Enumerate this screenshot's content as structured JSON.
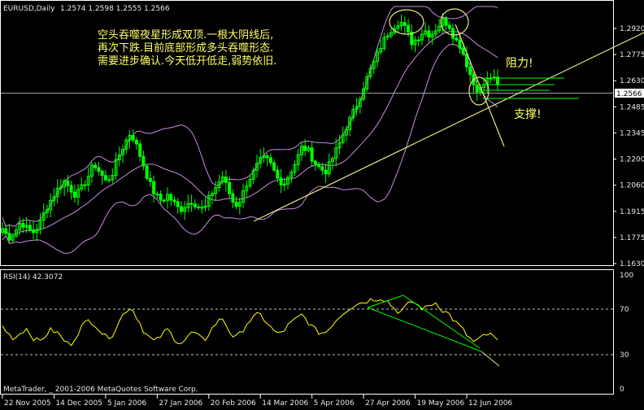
{
  "header": {
    "symbol": "EURUSD,Daily",
    "ohlc": "1.2574 1.2598 1.2555 1.2566"
  },
  "annotations": {
    "note_line1": "空头吞噬夜星形成双顶.一根大阴线后,",
    "note_line2": "再次下跌.目前底部形成多头吞噬形态.",
    "note_line3": "需要进步确认.今天低开低走,弱势依旧.",
    "resistance": "阻力!",
    "support": "支撑!"
  },
  "rsi_panel": {
    "title": "RSI(14) 42.3072",
    "copyright": "MetaTrader, _ 2001-2006 MetaQuotes Software Corp."
  },
  "colors": {
    "background": "#000000",
    "candle": "#00ff00",
    "bands": "#c88ce0",
    "trendline": "#e8e880",
    "rsi_line": "#ffff00",
    "axis": "#ffffff",
    "annotation_text": "#ffff66"
  },
  "chart_data": [
    {
      "type": "candlestick",
      "title": "EURUSD,Daily",
      "current_price": "1.2566",
      "ylim": [
        1.163,
        1.2995
      ],
      "y_ticks": [
        "1.2920",
        "1.2775",
        "1.2630",
        "1.2485",
        "1.2345",
        "1.2200",
        "1.2060",
        "1.1915",
        "1.1775",
        "1.1630"
      ],
      "x_ticks": [
        "22 Nov 2005",
        "14 Dec 2005",
        "5 Jan 2006",
        "27 Jan 2006",
        "20 Feb 2006",
        "14 Mar 2006",
        "5 Apr 2006",
        "27 Apr 2006",
        "19 May 2006",
        "12 Jun 2006"
      ],
      "indicators": [
        "Bollinger Bands"
      ],
      "close_path": [
        1.18,
        1.175,
        1.178,
        1.184,
        1.18,
        1.178,
        1.182,
        1.19,
        1.196,
        1.201,
        1.206,
        1.202,
        1.198,
        1.202,
        1.208,
        1.215,
        1.21,
        1.205,
        1.21,
        1.219,
        1.226,
        1.232,
        1.224,
        1.215,
        1.205,
        1.198,
        1.195,
        1.198,
        1.194,
        1.19,
        1.193,
        1.195,
        1.192,
        1.19,
        1.198,
        1.203,
        1.208,
        1.2,
        1.192,
        1.196,
        1.205,
        1.21,
        1.216,
        1.218,
        1.214,
        1.207,
        1.204,
        1.21,
        1.216,
        1.224,
        1.222,
        1.216,
        1.212,
        1.211,
        1.218,
        1.225,
        1.233,
        1.24,
        1.247,
        1.256,
        1.264,
        1.271,
        1.279,
        1.285,
        1.289,
        1.292,
        1.287,
        1.28,
        1.283,
        1.287,
        1.284,
        1.288,
        1.292,
        1.29,
        1.282,
        1.278,
        1.268,
        1.258,
        1.254,
        1.259,
        1.262,
        1.257
      ]
    },
    {
      "type": "line",
      "title": "RSI(14) 42.3072",
      "value": 42.3072,
      "ylim": [
        0,
        100
      ],
      "y_ticks": [
        "100",
        "70",
        "30",
        "0"
      ],
      "levels": [
        70,
        30
      ],
      "values": [
        55,
        48,
        44,
        50,
        53,
        45,
        41,
        47,
        52,
        49,
        43,
        38,
        46,
        55,
        60,
        58,
        51,
        45,
        48,
        58,
        68,
        72,
        63,
        52,
        45,
        41,
        47,
        52,
        45,
        40,
        43,
        50,
        46,
        42,
        51,
        58,
        62,
        52,
        44,
        49,
        58,
        62,
        66,
        60,
        53,
        48,
        51,
        57,
        61,
        65,
        59,
        52,
        49,
        50,
        57,
        63,
        68,
        72,
        75,
        76,
        78,
        79,
        80,
        77,
        71,
        67,
        72,
        77,
        73,
        70,
        74,
        76,
        69,
        66,
        59,
        54,
        47,
        41,
        43,
        48,
        47,
        42
      ]
    }
  ]
}
